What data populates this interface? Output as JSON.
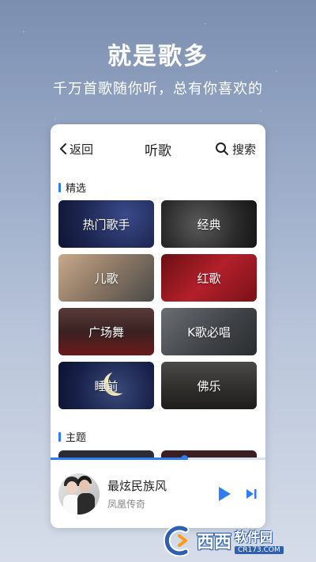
{
  "hero": {
    "title": "就是歌多",
    "subtitle": "千万首歌随你听，总有你喜欢的"
  },
  "topbar": {
    "back_label": "返回",
    "title": "听歌",
    "search_label": "搜索"
  },
  "sections": {
    "featured": "精选",
    "themes": "主题"
  },
  "categories": [
    {
      "label": "热门歌手"
    },
    {
      "label": "经典"
    },
    {
      "label": "儿歌"
    },
    {
      "label": "红歌"
    },
    {
      "label": "广场舞"
    },
    {
      "label": "K歌必唱"
    },
    {
      "label": "睡前"
    },
    {
      "label": "佛乐"
    }
  ],
  "player": {
    "song_title": "最炫民族风",
    "artist": "凤凰传奇",
    "progress": 0.62
  },
  "watermark": {
    "brand": "西西",
    "name": "软件园",
    "domain": "CR173.COM"
  },
  "colors": {
    "accent": "#2f7df6"
  },
  "icons": {
    "back": "chevron-left-icon",
    "search": "search-icon",
    "play": "play-icon",
    "next": "skip-next-icon"
  }
}
